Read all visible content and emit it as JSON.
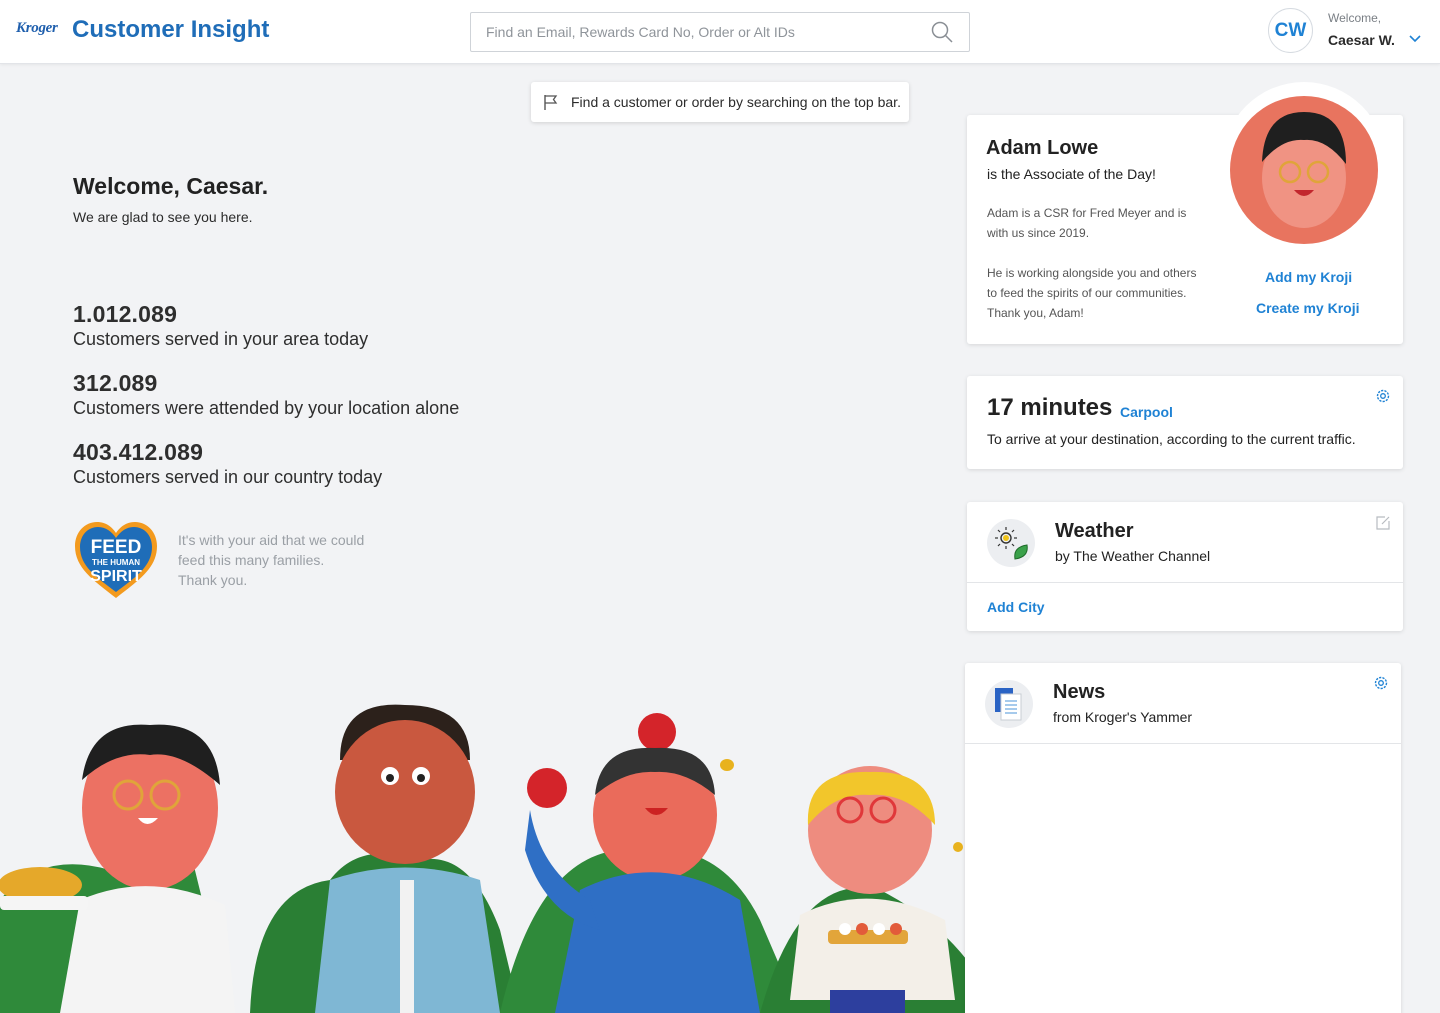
{
  "header": {
    "logo": "Kroger",
    "app_title": "Customer Insight",
    "search_placeholder": "Find an Email, Rewards Card No, Order or Alt IDs",
    "user": {
      "initials": "CW",
      "greeting": "Welcome,",
      "name": "Caesar W."
    }
  },
  "hint": {
    "text": "Find a customer or order by searching on the top bar."
  },
  "welcome": {
    "title": "Welcome, Caesar.",
    "subtitle": "We are glad to see you here."
  },
  "stats": [
    {
      "value": "1.012.089",
      "label": "Customers served in your area today"
    },
    {
      "value": "312.089",
      "label": "Customers were attended by your location alone"
    },
    {
      "value": "403.412.089",
      "label": "Customers served in our country today"
    }
  ],
  "feed": {
    "badge_lines": [
      "FEED",
      "THE HUMAN",
      "SPIRIT"
    ],
    "text_lines": [
      "It's with your aid that we could",
      "feed this many families.",
      "Thank you."
    ]
  },
  "associate": {
    "name": "Adam Lowe",
    "role": "is the Associate of the Day!",
    "p1": [
      "Adam is a CSR for Fred Meyer and is",
      "with us since 2019."
    ],
    "p2": [
      "He is working alongside you and others",
      "to feed the spirits of our communities.",
      "Thank you, Adam!"
    ],
    "add_link": "Add my Kroji",
    "create_link": "Create my Kroji"
  },
  "traffic": {
    "time": "17 minutes",
    "mode": "Carpool",
    "description": "To arrive at your destination, according to the current traffic."
  },
  "weather": {
    "title": "Weather",
    "subtitle": "by The Weather Channel",
    "add_city": "Add City"
  },
  "news": {
    "title": "News",
    "subtitle": "from Kroger's Yammer"
  },
  "colors": {
    "brand_blue": "#1f6db8",
    "link_blue": "#1f82d4",
    "background": "#f2f3f5"
  }
}
